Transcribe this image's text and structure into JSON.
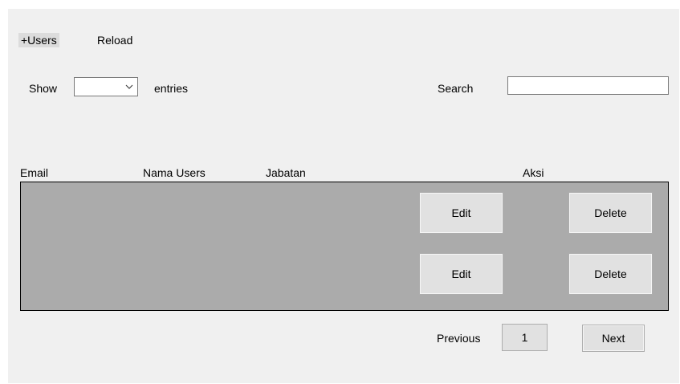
{
  "toolbar": {
    "add_users_label": "+Users",
    "reload_label": "Reload"
  },
  "filters": {
    "show_label": "Show",
    "entries_label": "entries",
    "entries_value": "",
    "search_label": "Search",
    "search_value": ""
  },
  "table": {
    "columns": [
      "Email",
      "Nama Users",
      "Jabatan",
      "Aksi"
    ],
    "rows": [
      {
        "email": "",
        "nama_users": "",
        "jabatan": "",
        "edit_label": "Edit",
        "delete_label": "Delete"
      },
      {
        "email": "",
        "nama_users": "",
        "jabatan": "",
        "edit_label": "Edit",
        "delete_label": "Delete"
      }
    ]
  },
  "pagination": {
    "previous_label": "Previous",
    "current_page": "1",
    "next_label": "Next"
  },
  "colors": {
    "form_background": "#f0f0f0",
    "grid_background": "#ababab",
    "button_face": "#e1e1e1"
  },
  "icons": {
    "combo_dropdown": "chevron-down-icon"
  }
}
